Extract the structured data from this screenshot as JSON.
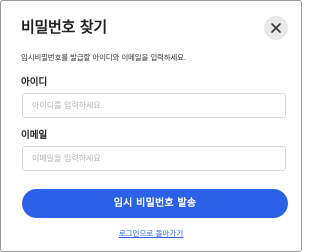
{
  "dialog": {
    "title": "비밀번호 찾기",
    "description": "임시비밀번호를 발급할 아이디와 이메일을 입력하세요.",
    "close_icon": "close-icon"
  },
  "form": {
    "id_label": "아이디",
    "id_value": "",
    "id_placeholder": "아이디를 입력하세요",
    "email_label": "이메일",
    "email_value": "",
    "email_placeholder": "이메일을 입력하세요"
  },
  "actions": {
    "submit_label": "임시 비밀번호 발송",
    "back_link": "로그인으로 돌아가기"
  },
  "colors": {
    "accent": "#2c61e7",
    "close_bg": "#e9e9e9",
    "border": "#d8d8d8"
  }
}
